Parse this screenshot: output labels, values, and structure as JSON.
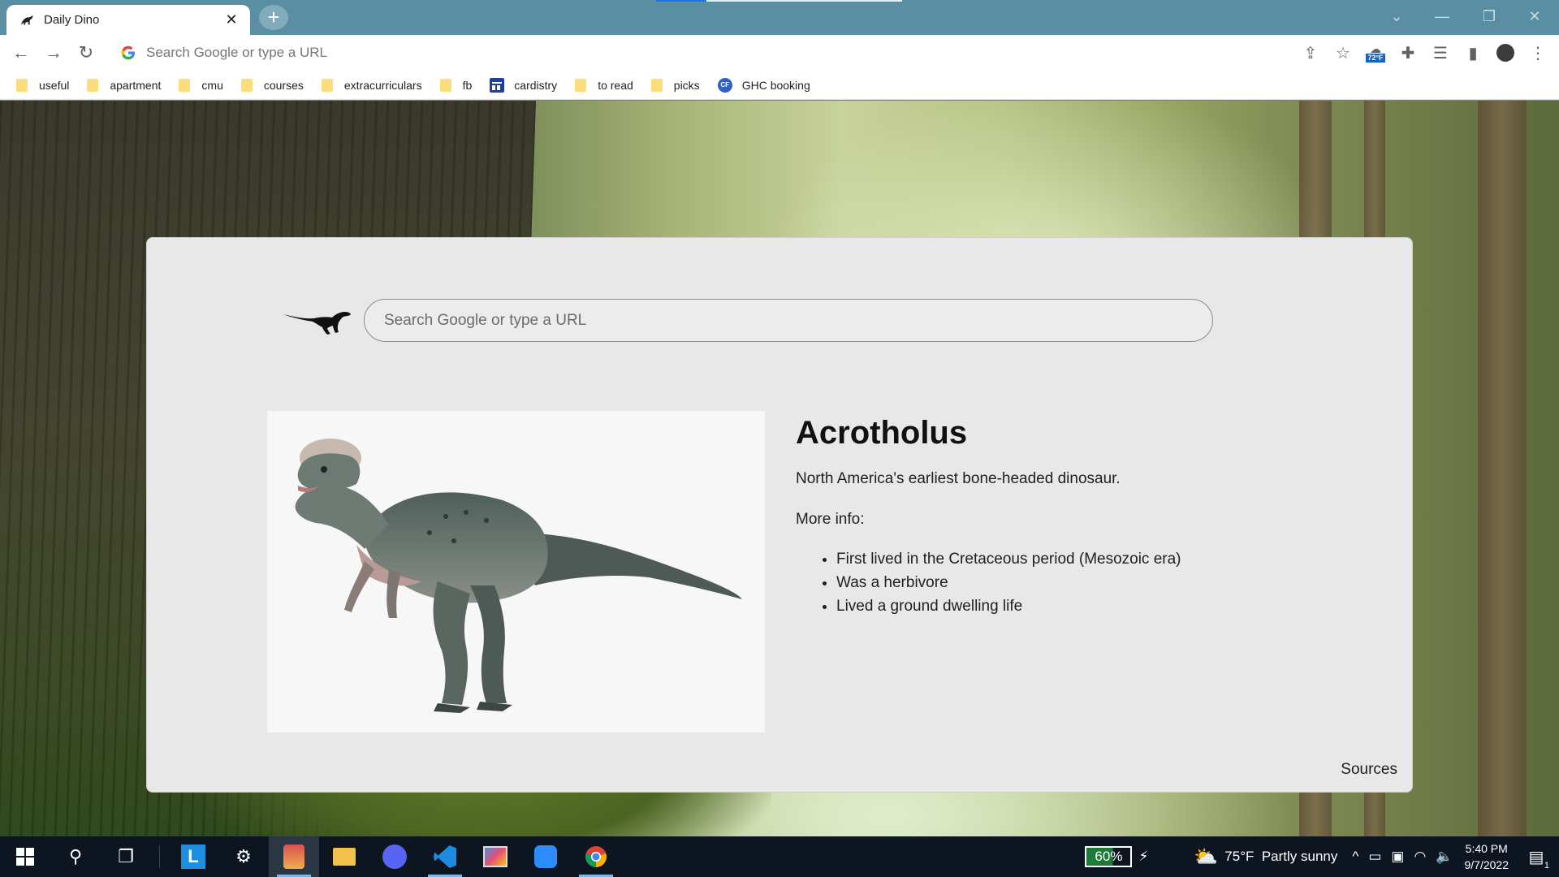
{
  "browser": {
    "tab": {
      "title": "Daily Dino",
      "close_icon": "close-icon"
    },
    "new_tab_label": "+",
    "omnibox": {
      "placeholder": "Search Google or type a URL"
    },
    "weather_badge": "72°F",
    "bookmarks": [
      {
        "label": "useful",
        "icon": "folder-icon"
      },
      {
        "label": "apartment",
        "icon": "folder-icon"
      },
      {
        "label": "cmu",
        "icon": "folder-icon"
      },
      {
        "label": "courses",
        "icon": "folder-icon"
      },
      {
        "label": "extracurriculars",
        "icon": "folder-icon"
      },
      {
        "label": "fb",
        "icon": "folder-icon"
      },
      {
        "label": "cardistry",
        "icon": "calendar-icon"
      },
      {
        "label": "to read",
        "icon": "folder-icon"
      },
      {
        "label": "picks",
        "icon": "folder-icon"
      },
      {
        "label": "GHC booking",
        "icon": "site-icon"
      }
    ],
    "site_icon_letters": "CF"
  },
  "page": {
    "search_placeholder": "Search Google or type a URL",
    "dino": {
      "name": "Acrotholus",
      "description": "North America's earliest bone-headed dinosaur.",
      "more_info_label": "More info:",
      "facts": [
        "First lived in the Cretaceous period (Mesozoic era)",
        "Was a herbivore",
        "Lived a ground dwelling life"
      ]
    },
    "sources_label": "Sources"
  },
  "taskbar": {
    "battery": "60%",
    "weather": "75°F  Partly sunny",
    "time": "5:40 PM",
    "date": "9/7/2022",
    "notifications": "1"
  },
  "colors": {
    "titlebar": "#5a8fa3",
    "card": "#e8e8e8",
    "taskbar": "#0d1520"
  }
}
